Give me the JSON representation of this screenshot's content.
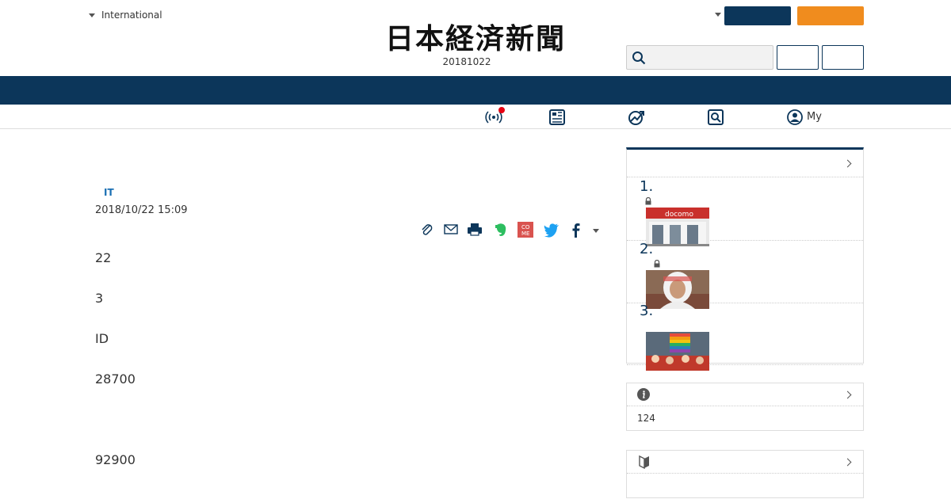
{
  "header": {
    "edition_label": "International",
    "logo_text": "日本経済新聞",
    "date": "20181022"
  },
  "subnav": {
    "my_label": "My"
  },
  "article": {
    "category": "IT",
    "published": "2018/10/22 15:09",
    "paragraphs": [
      "22",
      "3",
      "ID",
      "28700",
      "92900"
    ]
  },
  "sidebar": {
    "ranking": {
      "items": [
        {
          "rank": "1.",
          "locked": true
        },
        {
          "rank": "2.",
          "locked": true
        },
        {
          "rank": "3.",
          "locked": false
        }
      ]
    },
    "info": {
      "count": "124"
    }
  },
  "colors": {
    "navy": "#0c365a",
    "orange": "#f08c1e",
    "category_blue": "#1a6fb3",
    "live_red": "#e60012"
  },
  "icons": [
    "caret-down-icon",
    "search-icon",
    "live-broadcast-icon",
    "paper-edition-icon",
    "market-chart-icon",
    "search-lens-icon",
    "user-circle-icon",
    "clip-icon",
    "mail-icon",
    "print-icon",
    "evernote-icon",
    "come-icon",
    "twitter-icon",
    "facebook-icon",
    "lock-icon",
    "info-icon",
    "beginner-icon",
    "chevron-right-icon"
  ]
}
